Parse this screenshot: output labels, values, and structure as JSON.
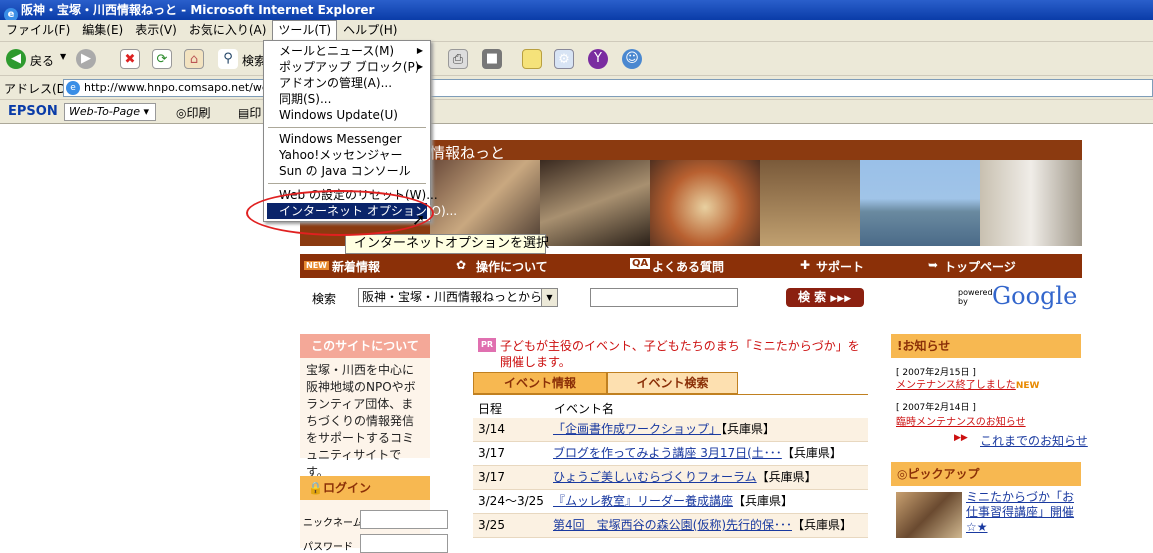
{
  "window": {
    "title": "阪神・宝塚・川西情報ねっと - Microsoft Internet Explorer"
  },
  "menubar": [
    "ファイル(F)",
    "編集(E)",
    "表示(V)",
    "お気に入り(A)",
    "ツール(T)",
    "ヘルプ(H)"
  ],
  "toolbar": {
    "back_label": "戻る",
    "search_label": "検索"
  },
  "address": {
    "label": "アドレス(D)",
    "url": "http://www.hnpo.comsapo.net/web"
  },
  "epson": {
    "brand": "EPSON",
    "webtopage": "Web-To-Page",
    "print": "印刷",
    "extra": "印"
  },
  "tools_menu": {
    "items": [
      "メールとニュース(M)",
      "ポップアップ ブロック(P)",
      "アドオンの管理(A)...",
      "同期(S)...",
      "Windows Update(U)",
      "Windows Messenger",
      "Yahoo!メッセンジャー",
      "Sun の Java コンソール",
      "Web の設定のリセット(W)...",
      "インターネット オプション(O)..."
    ],
    "selected": "インターネット オプション(O)..."
  },
  "tooltip": "インターネットオプションを選択",
  "site": {
    "banner_title": "情報ねっと",
    "nav": [
      "新着情報",
      "操作について",
      "よくある質問",
      "サポート",
      "トップページ"
    ],
    "search": {
      "label": "検索",
      "select_value": "阪神・宝塚・川西情報ねっとから",
      "button": "検 索",
      "powered": "powered by",
      "google": "Google"
    },
    "about": {
      "title": "このサイトについて",
      "text": "宝塚・川西を中心に阪神地域のNPOやボランティア団体、まちづくりの情報発信をサポートするコミュニティサイトです。"
    },
    "login": {
      "title": "ログイン",
      "nickname": "ニックネーム",
      "password": "パスワード"
    },
    "pr": {
      "badge": "PR",
      "text": "子どもが主役のイベント、子どもたちのまち「ミニたからづか」を開催します。"
    },
    "event_tabs": [
      "イベント情報",
      "イベント検索"
    ],
    "event_headers": [
      "日程",
      "イベント名"
    ],
    "events": [
      {
        "date": "3/14",
        "name": "「企画書作成ワークショップ」",
        "pref": "【兵庫県】"
      },
      {
        "date": "3/17",
        "name": "ブログを作ってみよう講座 3月17日(土･･･",
        "pref": "【兵庫県】"
      },
      {
        "date": "3/17",
        "name": "ひょうご美しいむらづくりフォーラム",
        "pref": "【兵庫県】"
      },
      {
        "date": "3/24〜3/25",
        "name": "『ムッレ教室』リーダー養成講座",
        "pref": "【兵庫県】"
      },
      {
        "date": "3/25",
        "name": "第4回　宝塚西谷の森公園(仮称)先行的保･･･",
        "pref": "【兵庫県】"
      }
    ],
    "notice": {
      "title": "お知らせ",
      "items": [
        {
          "date": "[ 2007年2月15日 ]",
          "text": "メンテナンス終了しました",
          "badge": "NEW"
        },
        {
          "date": "[ 2007年2月14日 ]",
          "text": "臨時メンテナンスのお知らせ"
        }
      ],
      "more": "これまでのお知らせ"
    },
    "pickup": {
      "title": "ピックアップ",
      "text": "ミニたからづか「お仕事習得講座」開催☆★"
    }
  },
  "colors": {
    "title_bar": "#0a3ca8",
    "chrome": "#ece9d8",
    "site_brown": "#8b3008",
    "accent_orange": "#f7b851",
    "menu_select": "#0a246a",
    "ring": "#e02020"
  }
}
